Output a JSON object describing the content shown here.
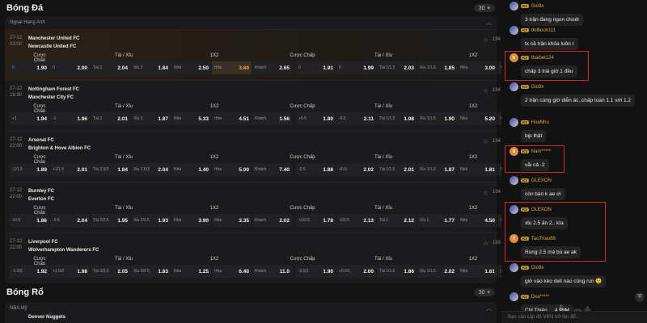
{
  "football": {
    "title": "Bóng Đá",
    "count": "30",
    "league": "Ngoại Hạng Anh",
    "col_headers": [
      "Cược Chấp",
      "Tài / Xỉu",
      "1X2",
      "Cược Chấp",
      "Tài / Xỉu",
      "1X2"
    ],
    "matches": [
      {
        "date": "27-12",
        "time": "03:00",
        "home": "Manchester United FC",
        "away": "Newcastle United FC",
        "count": "194",
        "highlight": true,
        "cells": [
          {
            "k": "0",
            "v": "1.90"
          },
          {
            "k": "0",
            "v": "2.00"
          },
          {
            "k": "Tài 3",
            "v": "2.04"
          },
          {
            "k": "Xỉu 3",
            "v": "1.84"
          },
          {
            "k": "Nhà",
            "v": "2.50"
          },
          {
            "k": "Hòa",
            "v": "3.60",
            "active": true
          },
          {
            "k": "Khách",
            "v": "2.65"
          },
          {
            "k": "0",
            "v": "1.91"
          },
          {
            "k": "0",
            "v": "1.99"
          },
          {
            "k": "Tài 1/1.5",
            "v": "2.03"
          },
          {
            "k": "Xỉu 1/1.5",
            "v": "1.85"
          },
          {
            "k": "Nhà",
            "v": "3.00"
          },
          {
            "k": "Hòa",
            "v": "2.36"
          }
        ]
      },
      {
        "date": "27-12",
        "time": "19:30",
        "home": "Nottingham Forest FC",
        "away": "Manchester City FC",
        "count": "194",
        "highlight": false,
        "cells": [
          {
            "k": "+1",
            "v": "1.94"
          },
          {
            "k": "-1",
            "v": "1.96"
          },
          {
            "k": "Tài 3",
            "v": "2.01"
          },
          {
            "k": "Xỉu 3",
            "v": "1.87"
          },
          {
            "k": "Nhà",
            "v": "5.33"
          },
          {
            "k": "Hòa",
            "v": "4.51"
          },
          {
            "k": "Khách",
            "v": "1.56"
          },
          {
            "k": "+0.5",
            "v": "1.80"
          },
          {
            "k": "-0.5",
            "v": "2.11"
          },
          {
            "k": "Tài 1/1.5",
            "v": "1.98"
          },
          {
            "k": "Xỉu 1/1.5",
            "v": "1.90"
          },
          {
            "k": "Nhà",
            "v": "5.20"
          },
          {
            "k": "Hòa",
            "v": "2.50"
          }
        ]
      },
      {
        "date": "27-12",
        "time": "22:00",
        "home": "Arsenal FC",
        "away": "Brighton & Hove Albion FC",
        "count": "194",
        "highlight": false,
        "cells": [
          {
            "k": "-1/1.5",
            "v": "1.89"
          },
          {
            "k": "+1/1.5",
            "v": "2.01"
          },
          {
            "k": "Tài 2.5/3",
            "v": "1.84"
          },
          {
            "k": "Xỉu 2.5/3",
            "v": "2.04"
          },
          {
            "k": "Nhà",
            "v": "1.40"
          },
          {
            "k": "Hòa",
            "v": "5.00"
          },
          {
            "k": "Khách",
            "v": "7.40"
          },
          {
            "k": "-0.5",
            "v": "1.88"
          },
          {
            "k": "+0.5",
            "v": "2.02"
          },
          {
            "k": "Tài 1/1.5",
            "v": "2.01"
          },
          {
            "k": "Xỉu 1/1.5",
            "v": "1.87"
          },
          {
            "k": "Nhà",
            "v": "1.81"
          },
          {
            "k": "Hòa",
            "v": "2.60"
          }
        ]
      },
      {
        "date": "27-12",
        "time": "22:00",
        "home": "Burnley FC",
        "away": "Everton FC",
        "count": "194",
        "highlight": false,
        "cells": [
          {
            "k": "+0.5",
            "v": "1.86"
          },
          {
            "k": "-0.5",
            "v": "2.04"
          },
          {
            "k": "Tài 2/2.5",
            "v": "1.95"
          },
          {
            "k": "Xỉu 2/2.5",
            "v": "1.93"
          },
          {
            "k": "Nhà",
            "v": "3.90"
          },
          {
            "k": "Hòa",
            "v": "3.35"
          },
          {
            "k": "Khách",
            "v": "2.02"
          },
          {
            "k": "+0/0.5",
            "v": "1.78"
          },
          {
            "k": "-0/0.5",
            "v": "2.13"
          },
          {
            "k": "Tài 1",
            "v": "2.12"
          },
          {
            "k": "Xỉu 1",
            "v": "1.77"
          },
          {
            "k": "Nhà",
            "v": "4.50"
          },
          {
            "k": "Hòa",
            "v": "2.08"
          }
        ]
      },
      {
        "date": "27-12",
        "time": "22:00",
        "home": "Liverpool FC",
        "away": "Wolverhampton Wanderers FC",
        "count": "193",
        "highlight": false,
        "cells": [
          {
            "k": "-1.5/2",
            "v": "1.92"
          },
          {
            "k": "+1.5/2",
            "v": "1.98"
          },
          {
            "k": "Tài 3/3.5",
            "v": "2.05"
          },
          {
            "k": "Xỉu 3/3.5",
            "v": "1.83"
          },
          {
            "k": "Nhà",
            "v": "1.25"
          },
          {
            "k": "Hòa",
            "v": "6.40"
          },
          {
            "k": "Khách",
            "v": "11.0"
          },
          {
            "k": "-0.5/1",
            "v": "1.90"
          },
          {
            "k": "+0.5/1",
            "v": "2.00"
          },
          {
            "k": "Tài 1/1.5",
            "v": "1.86"
          },
          {
            "k": "Xỉu 1/1.5",
            "v": "2.02"
          },
          {
            "k": "Nhà",
            "v": "1.61"
          },
          {
            "k": "Hòa",
            "v": "2.90"
          }
        ]
      }
    ]
  },
  "basketball": {
    "title": "Bóng Rổ",
    "count": "30",
    "league": "NBA Mỹ",
    "first_team": "Denver Nuggets"
  },
  "chat": {
    "messages": [
      {
        "user": "Gio9x",
        "text": "3 trận đang ngon choét",
        "avatar": "img",
        "letter": ""
      },
      {
        "user": "dolbuon111",
        "text": "tx cả trận khỏa luôn r",
        "avatar": "img",
        "letter": ""
      },
      {
        "user": "thaibet124",
        "text": "chấp 3 trái giờ 1 đều",
        "avatar": "letter",
        "letter": "K"
      },
      {
        "user": "Gio9x",
        "text": "2 trận cùng giờ diễn ác..chấp toàn 1.1 với 1.2",
        "avatar": "img",
        "letter": ""
      },
      {
        "user": "HoaNhu",
        "text": "bịp thật",
        "avatar": "img",
        "letter": ""
      },
      {
        "user": "Nam*****",
        "text": "vãi cả -2",
        "avatar": "letter",
        "letter": "N"
      },
      {
        "user": "OLEXON",
        "text": "còn bàn k ae ơi",
        "avatar": "img",
        "letter": ""
      },
      {
        "user": "OLEXON",
        "text": "xỉu 2.5 ăn 2.. kìa",
        "avatar": "img",
        "letter": ""
      },
      {
        "user": "TaoThao88",
        "text": "Rung 2.5 mà bú ae ak",
        "avatar": "letter",
        "letter": "T"
      },
      {
        "user": "Gio9x",
        "text": "giờ vào kèo dell nào cũng run 😉",
        "avatar": "img",
        "letter": ""
      },
      {
        "user": "Dxa*****",
        "text": "Chỉ Thiên ... 4.95M",
        "avatar": "img",
        "letter": ""
      }
    ],
    "badge": "K3",
    "input_placeholder": "Bạn cần cấp độ VIP3 trở lên để...",
    "watermark": "bet"
  }
}
